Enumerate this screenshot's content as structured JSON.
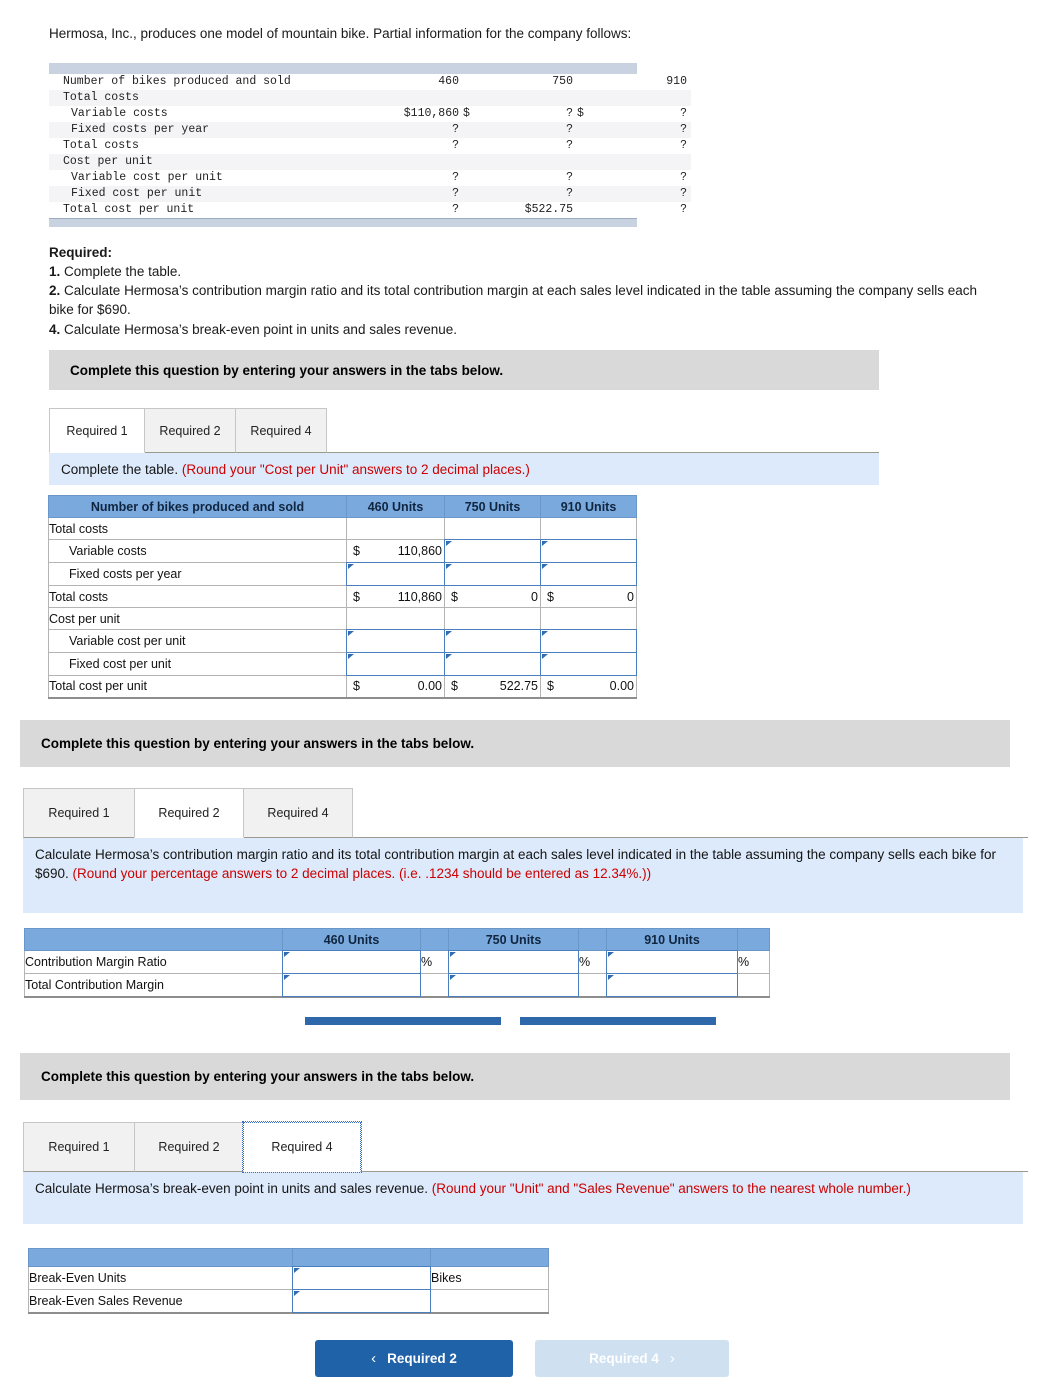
{
  "intro": "Hermosa, Inc., produces one model of mountain bike. Partial information for the company follows:",
  "given_table": {
    "rows": [
      {
        "label": "Number of bikes produced and sold",
        "indent": 0,
        "shade": false,
        "c1": "460",
        "c1_dollar": "",
        "c2": "750",
        "c2_dollar": "",
        "c3": "910",
        "c3_dollar": ""
      },
      {
        "label": "Total costs",
        "indent": 0,
        "shade": true,
        "c1": "",
        "c1_dollar": "",
        "c2": "",
        "c2_dollar": "",
        "c3": "",
        "c3_dollar": ""
      },
      {
        "label": "Variable costs",
        "indent": 1,
        "shade": false,
        "c1": "$110,860",
        "c1_dollar": "",
        "c2": "?",
        "c2_dollar": "$",
        "c3": "?",
        "c3_dollar": "$"
      },
      {
        "label": "Fixed costs per year",
        "indent": 1,
        "shade": true,
        "c1": "?",
        "c1_dollar": "",
        "c2": "?",
        "c2_dollar": "",
        "c3": "?",
        "c3_dollar": ""
      },
      {
        "label": "Total costs",
        "indent": 0,
        "shade": false,
        "c1": "?",
        "c1_dollar": "",
        "c2": "?",
        "c2_dollar": "",
        "c3": "?",
        "c3_dollar": ""
      },
      {
        "label": "Cost per unit",
        "indent": 0,
        "shade": true,
        "c1": "",
        "c1_dollar": "",
        "c2": "",
        "c2_dollar": "",
        "c3": "",
        "c3_dollar": ""
      },
      {
        "label": "Variable cost per unit",
        "indent": 1,
        "shade": false,
        "c1": "?",
        "c1_dollar": "",
        "c2": "?",
        "c2_dollar": "",
        "c3": "?",
        "c3_dollar": ""
      },
      {
        "label": "Fixed cost per unit",
        "indent": 1,
        "shade": true,
        "c1": "?",
        "c1_dollar": "",
        "c2": "?",
        "c2_dollar": "",
        "c3": "?",
        "c3_dollar": ""
      },
      {
        "label": "Total cost per unit",
        "indent": 0,
        "shade": false,
        "c1": "?",
        "c1_dollar": "",
        "c2": "$522.75",
        "c2_dollar": "",
        "c3": "?",
        "c3_dollar": ""
      }
    ]
  },
  "required": {
    "heading": "Required:",
    "item1_num": "1.",
    "item1_text": "Complete the table.",
    "item2_num": "2.",
    "item2_text": "Calculate Hermosa’s contribution margin ratio and its total contribution margin at each sales level indicated in the table assuming the company sells each bike for $690.",
    "item4_num": "4.",
    "item4_text": "Calculate Hermosa’s break-even point in units and sales revenue."
  },
  "panel1": {
    "banner": "Complete this question by entering your answers in the tabs below.",
    "tabs": [
      {
        "label": "Required 1",
        "state": "active"
      },
      {
        "label": "Required 2",
        "state": "inactive"
      },
      {
        "label": "Required 4",
        "state": "inactive"
      }
    ],
    "instruction_plain": "Complete the table. ",
    "instruction_red": "(Round your \"Cost per Unit\" answers to 2 decimal places.)",
    "table": {
      "headers": [
        "Number of bikes produced and sold",
        "460 Units",
        "750 Units",
        "910 Units"
      ],
      "rows": [
        {
          "label": "Total costs",
          "indent": 0,
          "type": "blank"
        },
        {
          "label": "Variable costs",
          "indent": 1,
          "type": "mixed",
          "c1_dollar": "$",
          "c1_value": "110,860",
          "c2": "input",
          "c3": "input"
        },
        {
          "label": "Fixed costs per year",
          "indent": 1,
          "type": "inputs"
        },
        {
          "label": "Total costs",
          "indent": 0,
          "type": "values",
          "c1_dollar": "$",
          "c1_value": "110,860",
          "c2_dollar": "$",
          "c2_value": "0",
          "c3_dollar": "$",
          "c3_value": "0"
        },
        {
          "label": "Cost per unit",
          "indent": 0,
          "type": "blank"
        },
        {
          "label": "Variable cost per unit",
          "indent": 1,
          "type": "inputs"
        },
        {
          "label": "Fixed cost per unit",
          "indent": 1,
          "type": "inputs"
        },
        {
          "label": "Total cost per unit",
          "indent": 0,
          "type": "values",
          "c1_dollar": "$",
          "c1_value": "0.00",
          "c2_dollar": "$",
          "c2_value": "522.75",
          "c3_dollar": "$",
          "c3_value": "0.00"
        }
      ]
    }
  },
  "panel2": {
    "banner": "Complete this question by entering your answers in the tabs below.",
    "tabs": [
      {
        "label": "Required 1",
        "state": "inactive"
      },
      {
        "label": "Required 2",
        "state": "active"
      },
      {
        "label": "Required 4",
        "state": "inactive"
      }
    ],
    "instruction_plain": "Calculate Hermosa’s contribution margin ratio and its total contribution margin at each sales level indicated in the table assuming the company sells each bike for $690. ",
    "instruction_red": "(Round your percentage answers to 2 decimal places. (i.e. .1234 should be entered as 12.34%.))",
    "table": {
      "headers": [
        "",
        "460 Units",
        "",
        "750 Units",
        "",
        "910 Units",
        ""
      ],
      "rows": [
        {
          "label": "Contribution Margin Ratio",
          "suffix1": "%",
          "suffix2": "%",
          "suffix3": "%"
        },
        {
          "label": "Total Contribution Margin",
          "suffix1": "",
          "suffix2": "",
          "suffix3": ""
        }
      ]
    }
  },
  "panel3": {
    "banner": "Complete this question by entering your answers in the tabs below.",
    "tabs": [
      {
        "label": "Required 1",
        "state": "inactive"
      },
      {
        "label": "Required 2",
        "state": "inactive"
      },
      {
        "label": "Required 4",
        "state": "focused"
      }
    ],
    "instruction_plain": "Calculate Hermosa’s break-even point in units and sales revenue. ",
    "instruction_red": "(Round your \"Unit\" and \"Sales Revenue\" answers to the nearest whole number.)",
    "table": {
      "headers": [
        "",
        "",
        ""
      ],
      "rows": [
        {
          "label": "Break-Even Units",
          "unit": "Bikes"
        },
        {
          "label": "Break-Even Sales Revenue",
          "unit": ""
        }
      ]
    }
  },
  "footer": {
    "prev_label": "Required 2",
    "prev_chevron": "‹",
    "next_label": "Required 4",
    "next_chevron": "›"
  },
  "colors": {
    "header_blue": "#7aa9de",
    "instruction_blue": "#ddeafb",
    "banner_gray": "#d9d9d9",
    "red_text": "#cc0000",
    "button_blue": "#1f62a8",
    "button_disabled": "#cfe0f0",
    "scroll_thumb": "#2e68ab"
  }
}
